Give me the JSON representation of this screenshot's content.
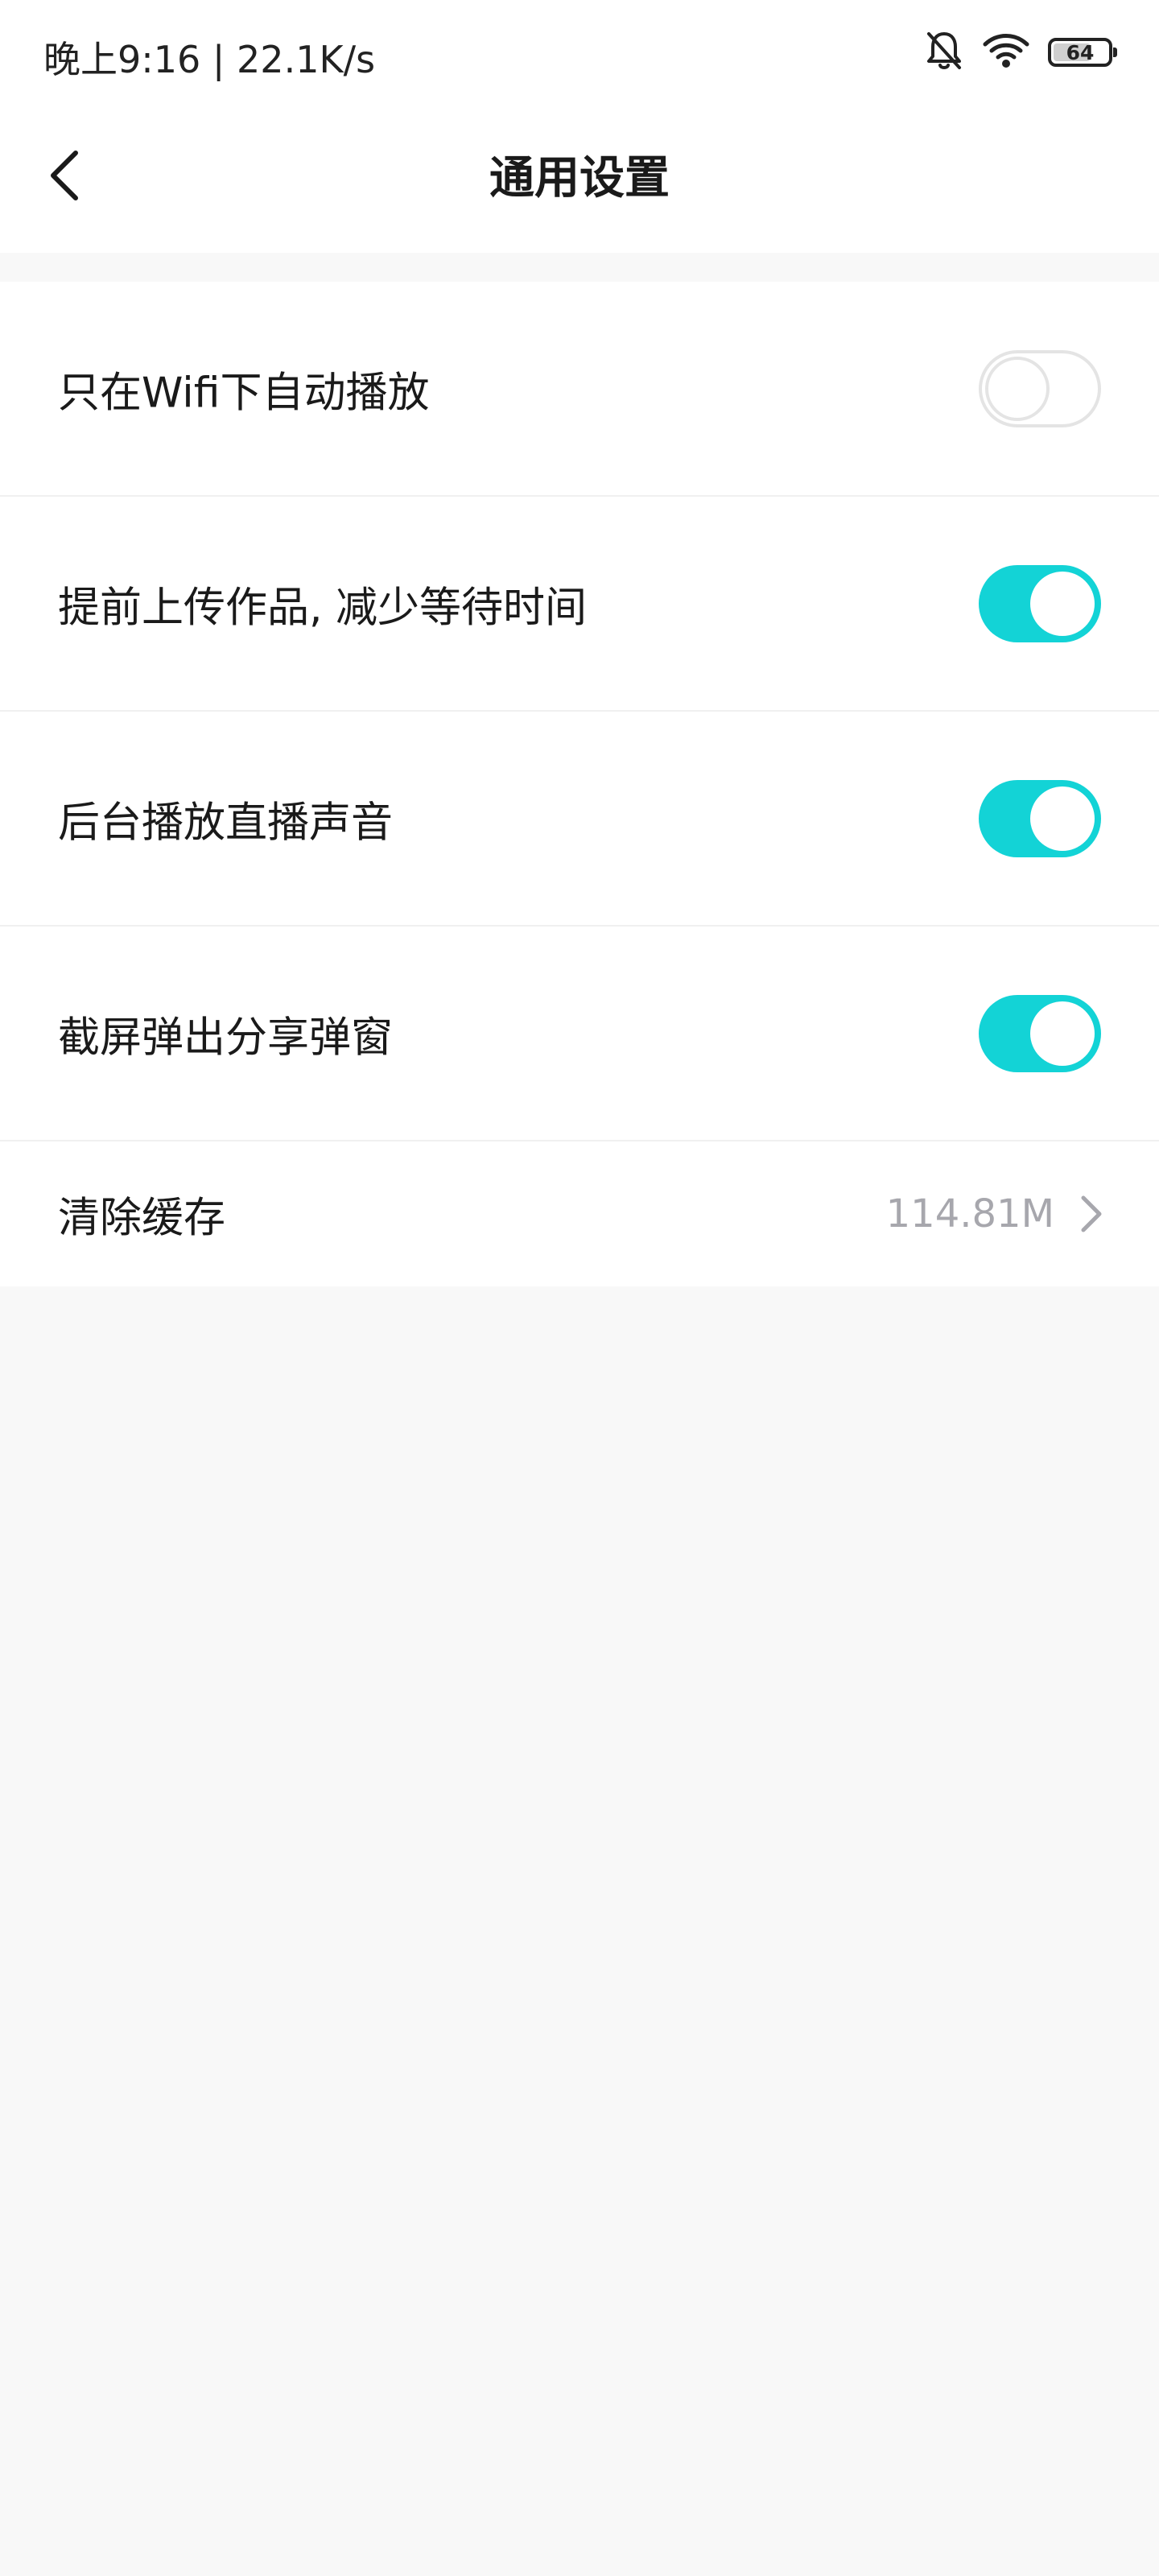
{
  "status_bar": {
    "time_speed": "晚上9:16 | 22.1K/s",
    "battery_level": "64",
    "icons": [
      "bell-muted-icon",
      "wifi-icon",
      "battery-icon"
    ]
  },
  "nav": {
    "title": "通用设置",
    "back_icon": "chevron-left-icon"
  },
  "settings": [
    {
      "label": "只在Wifi下自动播放",
      "enabled": false
    },
    {
      "label": "提前上传作品, 减少等待时间",
      "enabled": true
    },
    {
      "label": "后台播放直播声音",
      "enabled": true
    },
    {
      "label": "截屏弹出分享弹窗",
      "enabled": true
    }
  ],
  "cache": {
    "label": "清除缓存",
    "value": "114.81M",
    "icon": "chevron-right-icon"
  },
  "colors": {
    "accent": "#13d3d6",
    "toggle_off_border": "#e4e4e4",
    "secondary_text": "#a7a7ad",
    "page_background": "#f8f8f8"
  }
}
